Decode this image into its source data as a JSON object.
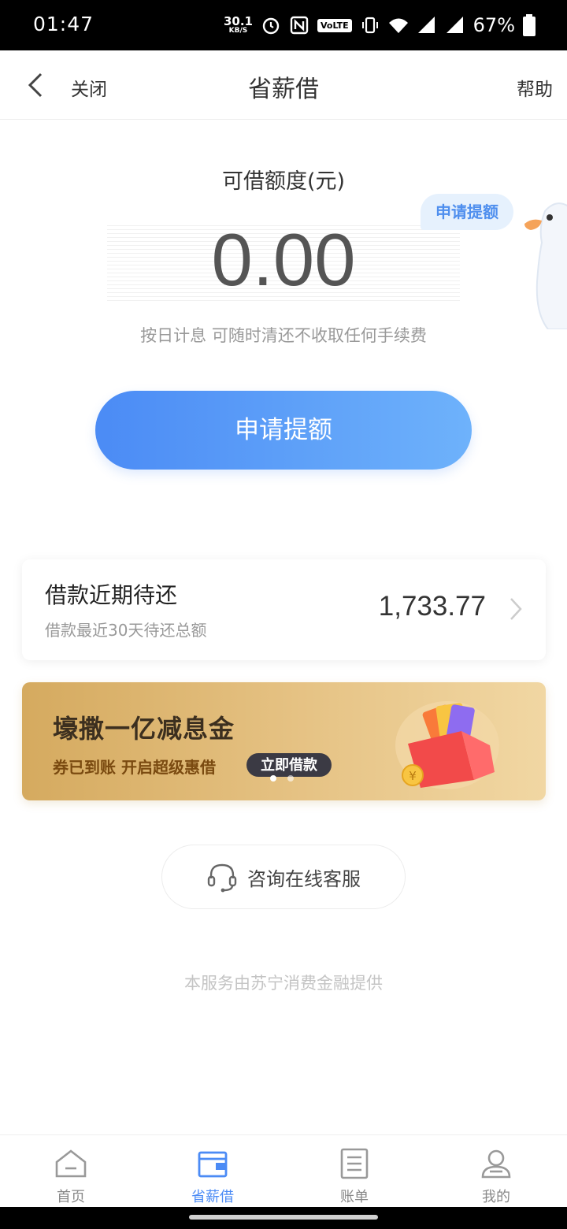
{
  "status_bar": {
    "time": "01:47",
    "net_speed_value": "30.1",
    "net_speed_unit": "KB/S",
    "volte": "VoLTE",
    "battery": "67%"
  },
  "nav": {
    "close_label": "关闭",
    "title": "省薪借",
    "help_label": "帮助"
  },
  "credit": {
    "label": "可借额度(元)",
    "amount": "0.00",
    "tag": "申请提额",
    "note": "按日计息 可随时清还不收取任何手续费",
    "button": "申请提额"
  },
  "repayment": {
    "title": "借款近期待还",
    "subtitle": "借款最近30天待还总额",
    "amount": "1,733.77"
  },
  "banner": {
    "title": "壕撒一亿减息金",
    "subtitle": "券已到账  开启超级惠借",
    "button": "立即借款",
    "page_count": 2,
    "active_index": 0
  },
  "service": {
    "button": "咨询在线客服"
  },
  "footer": {
    "provider": "本服务由苏宁消费金融提供"
  },
  "tabbar": {
    "items": [
      {
        "label": "首页",
        "icon": "home-icon",
        "active": false
      },
      {
        "label": "省薪借",
        "icon": "wallet-icon",
        "active": true
      },
      {
        "label": "账单",
        "icon": "bill-icon",
        "active": false
      },
      {
        "label": "我的",
        "icon": "profile-icon",
        "active": false
      }
    ]
  },
  "colors": {
    "primary": "#4b8bf5",
    "banner_gold": "#e6c385",
    "status_bar": "#000000"
  }
}
